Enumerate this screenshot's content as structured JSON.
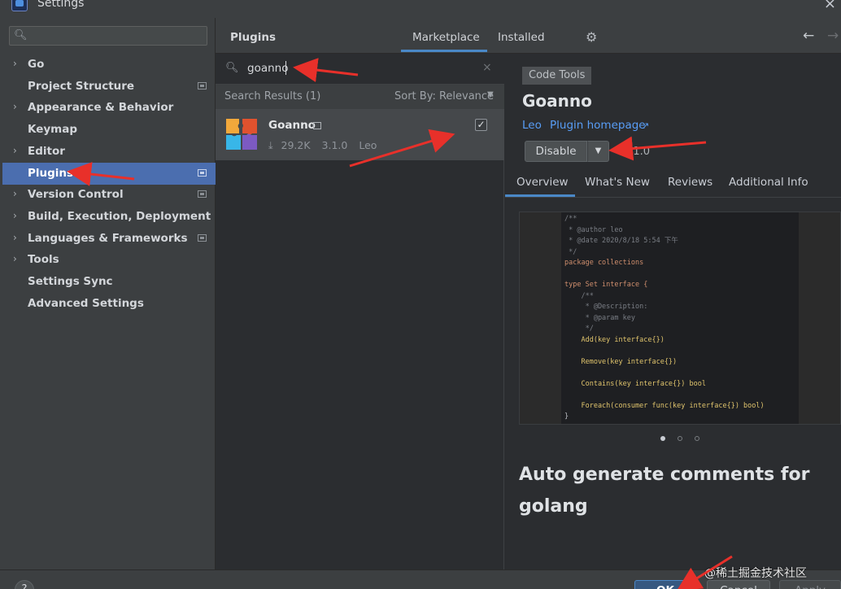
{
  "window": {
    "title": "Settings",
    "close_glyph": "×"
  },
  "sidebar": {
    "search_placeholder": "",
    "items": [
      {
        "label": "Go",
        "expandable": true,
        "project_icon": false
      },
      {
        "label": "Project Structure",
        "expandable": false,
        "project_icon": true
      },
      {
        "label": "Appearance & Behavior",
        "expandable": true,
        "project_icon": false
      },
      {
        "label": "Keymap",
        "expandable": false,
        "project_icon": false
      },
      {
        "label": "Editor",
        "expandable": true,
        "project_icon": false
      },
      {
        "label": "Plugins",
        "expandable": false,
        "project_icon": true,
        "selected": true
      },
      {
        "label": "Version Control",
        "expandable": true,
        "project_icon": true
      },
      {
        "label": "Build, Execution, Deployment",
        "expandable": true,
        "project_icon": false
      },
      {
        "label": "Languages & Frameworks",
        "expandable": true,
        "project_icon": true
      },
      {
        "label": "Tools",
        "expandable": true,
        "project_icon": false
      },
      {
        "label": "Settings Sync",
        "expandable": false,
        "project_icon": false
      },
      {
        "label": "Advanced Settings",
        "expandable": false,
        "project_icon": false
      }
    ]
  },
  "plugins_header": {
    "title": "Plugins",
    "tabs": [
      "Marketplace",
      "Installed"
    ],
    "active_tab": "Marketplace"
  },
  "search": {
    "value": "goanno",
    "results_label": "Search Results (1)",
    "sort_label": "Sort By: Relevance"
  },
  "plugin_item": {
    "name": "Goanno",
    "downloads": "29.2K",
    "version": "3.1.0",
    "vendor": "Leo",
    "installed": true
  },
  "detail": {
    "category": "Code Tools",
    "name": "Goanno",
    "vendor_link": "Leo",
    "homepage_link": "Plugin homepage",
    "homepage_arrow": "↗",
    "action_button": "Disable",
    "version": "3.1.0",
    "tabs": [
      "Overview",
      "What's New",
      "Reviews",
      "Additional Info"
    ],
    "active_tab": "Overview",
    "description": "Auto generate comments for golang",
    "code_lines": [
      {
        "cls": "c-cmt",
        "text": "/**"
      },
      {
        "cls": "c-cmt",
        "text": " * @author leo"
      },
      {
        "cls": "c-cmt",
        "text": " * @date 2020/8/18 5:54 下午"
      },
      {
        "cls": "c-cmt",
        "text": " */"
      },
      {
        "cls": "c-kw",
        "text": "package collections"
      },
      {
        "cls": "c-txt",
        "text": ""
      },
      {
        "cls": "c-kw",
        "text": "type Set interface {"
      },
      {
        "cls": "c-cmt",
        "text": "    /**"
      },
      {
        "cls": "c-cmt",
        "text": "     * @Description:"
      },
      {
        "cls": "c-cmt",
        "text": "     * @param key"
      },
      {
        "cls": "c-cmt",
        "text": "     */"
      },
      {
        "cls": "c-fn",
        "text": "    Add(key interface{})"
      },
      {
        "cls": "c-txt",
        "text": ""
      },
      {
        "cls": "c-fn",
        "text": "    Remove(key interface{})"
      },
      {
        "cls": "c-txt",
        "text": ""
      },
      {
        "cls": "c-fn",
        "text": "    Contains(key interface{}) bool"
      },
      {
        "cls": "c-txt",
        "text": ""
      },
      {
        "cls": "c-fn",
        "text": "    Foreach(consumer func(key interface{}) bool)"
      },
      {
        "cls": "c-txt",
        "text": "}"
      }
    ]
  },
  "footer": {
    "help_label": "?",
    "ok_label": "OK",
    "cancel_label": "Cancel",
    "apply_label": "Apply",
    "watermark": "@稀土掘金技术社区"
  },
  "colors": {
    "selection": "#4b6eaf",
    "accent_underline": "#4a88c7",
    "link": "#589df6",
    "annotation_arrow": "#e8302a"
  }
}
